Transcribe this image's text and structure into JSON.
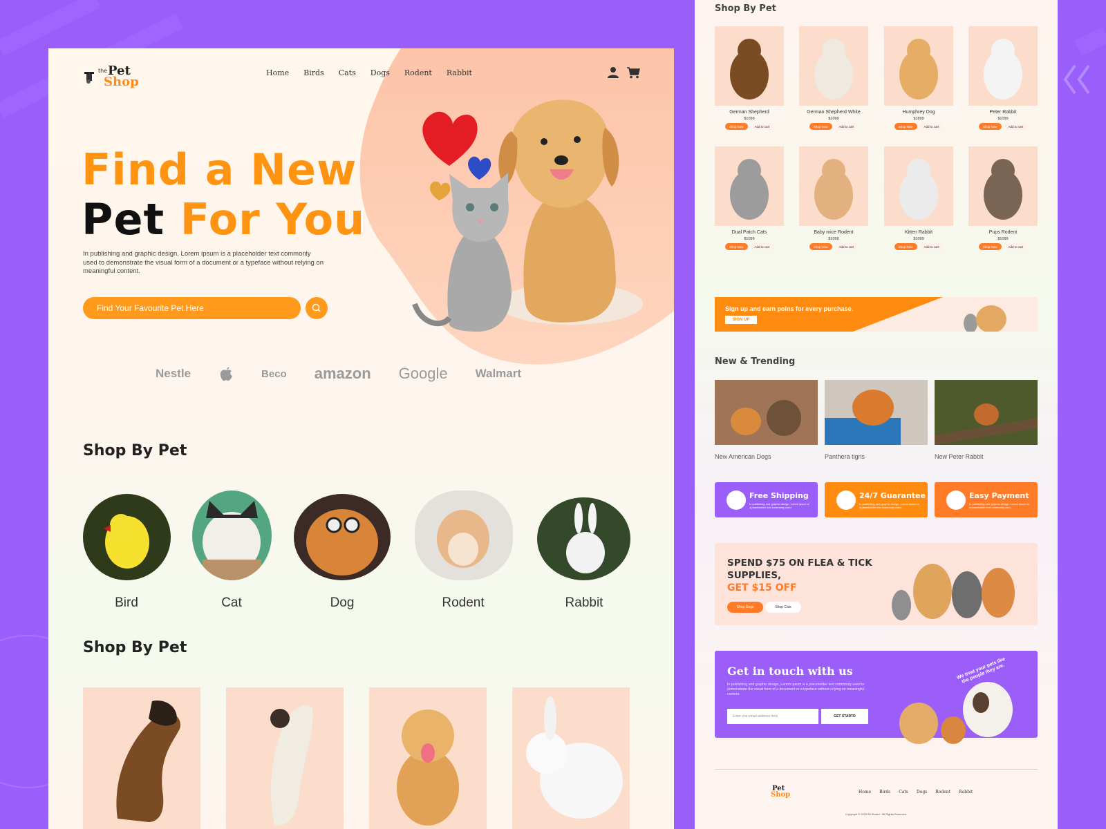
{
  "brand": {
    "the": "the",
    "pet": "Pet",
    "shop": "Shop"
  },
  "nav": [
    "Home",
    "Birds",
    "Cats",
    "Dogs",
    "Rodent",
    "Rabbit"
  ],
  "hero": {
    "line1": "Find a New",
    "line2a": "Pet",
    "line2b": "For You",
    "paragraph": "In publishing and graphic design, Lorem ipsum is a placeholder text commonly used to demonstrate the visual form of a document or a typeface without relying on meaningful content.",
    "search_placeholder": "Find Your Favourite Pet Here"
  },
  "brands": [
    "Nestle",
    "Beco",
    "amazon",
    "Google",
    "Walmart"
  ],
  "shop_by_pet_title": "Shop By Pet",
  "categories": [
    "Bird",
    "Cat",
    "Dog",
    "Rodent",
    "Rabbit"
  ],
  "products": [
    {
      "name": "German Shepherd",
      "price": "$1099"
    },
    {
      "name": "German Shepherd White",
      "price": "$1099"
    },
    {
      "name": "Humphrey Dog",
      "price": "$1899"
    },
    {
      "name": "Peter Rabbit",
      "price": "$1099"
    },
    {
      "name": "Dual Patch Cats",
      "price": "$1099"
    },
    {
      "name": "Baby mice Rodent",
      "price": "$1099"
    },
    {
      "name": "Kitten Rabbit",
      "price": "$1099"
    },
    {
      "name": "Pups Rodent",
      "price": "$1099"
    }
  ],
  "product_buttons": {
    "shop": "Shop Now",
    "cart": "Add to cart"
  },
  "signup": {
    "text": "Sign up and earn poins for every purchase.",
    "button": "SIGN UP"
  },
  "trending_title": "New & Trending",
  "trending": [
    "New American Dogs",
    "Panthera tigris",
    "New Peter Rabbit"
  ],
  "features": [
    {
      "title": "Free Shipping",
      "sub": "In publishing and graphic design, Lorem ipsum is a placeholder text commonly used."
    },
    {
      "title": "24/7 Guarantee",
      "sub": "In publishing and graphic design, Lorem ipsum is a placeholder text commonly used."
    },
    {
      "title": "Easy Payment",
      "sub": "In publishing and graphic design, Lorem ipsum is a placeholder text commonly used."
    }
  ],
  "promo": {
    "line1": "SPEND $75 ON FLEA & TICK",
    "line2": "SUPPLIES,",
    "offer": "GET $15 OFF",
    "btn1": "Shop Dogs",
    "btn2": "Shop Cats"
  },
  "contact": {
    "title": "Get in touch with us",
    "text": "In publishing and graphic design, Lorem ipsum is a placeholder text commonly used to demonstrate the visual form of a document or a typeface without relying on meaningful content.",
    "email_placeholder": "Enter you email address here",
    "button": "GET STARTD",
    "tagline": "We treat your pets like the people they are."
  },
  "footer_nav": [
    "Home",
    "Birds",
    "Cats",
    "Dogs",
    "Rodent",
    "Rabbit"
  ],
  "copyright": "Copyright © 2023 All Shalini . All Rights Reserved.",
  "colors": {
    "purple": "#9a5ffb",
    "orange": "#ff9412",
    "peach": "#fcdcca"
  }
}
